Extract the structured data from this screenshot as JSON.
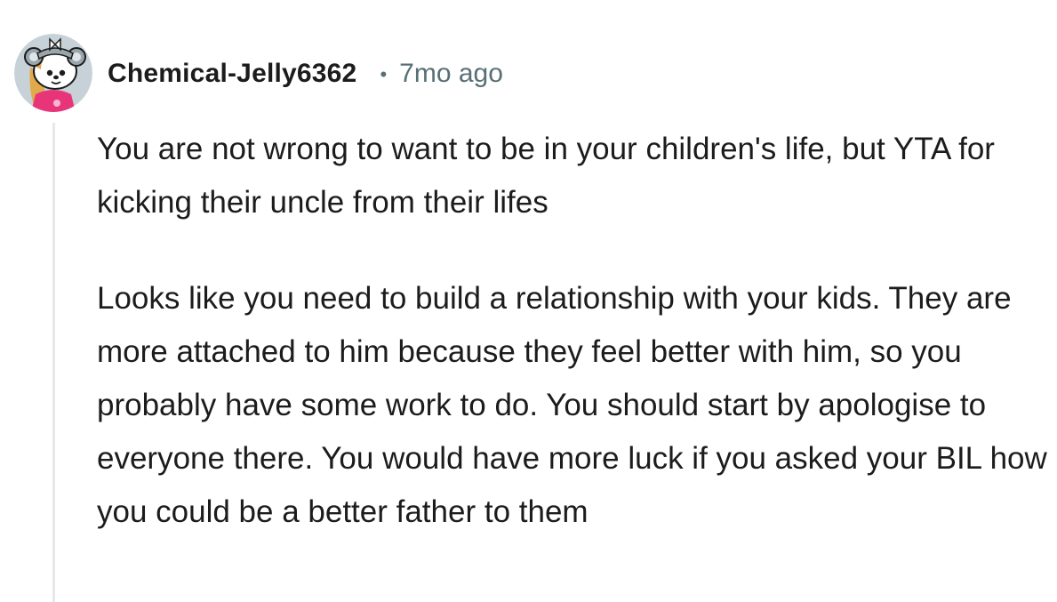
{
  "comment": {
    "username": "Chemical-Jelly6362",
    "separator": "•",
    "timestamp": "7mo ago",
    "avatar_icon": "reddit-snoo-avatar-icon",
    "paragraphs": [
      "You are not wrong to want to be in your children's life, but YTA for kicking their uncle from their lifes",
      "Looks like you need to build a relationship with your kids. They are more attached to him because they feel better with him, so you probably have some work to do. You should start by apologise to everyone there. You would have more luck if you asked your BIL how you could be a better father to them"
    ]
  },
  "colors": {
    "text": "#1c1c1c",
    "meta": "#576f76",
    "thread_line": "#e5e7e9",
    "avatar_bg": "#c7d2d8",
    "avatar_shirt": "#e8357a"
  }
}
